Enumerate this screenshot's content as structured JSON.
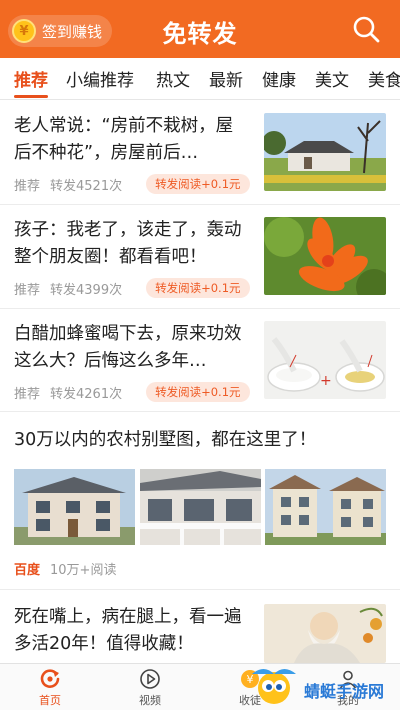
{
  "header": {
    "signin_label": "签到赚钱",
    "title": "免转发"
  },
  "tabs": [
    "推荐",
    "小编推荐",
    "热文",
    "最新",
    "健康",
    "美文",
    "美食"
  ],
  "articles": [
    {
      "title": "老人常说：“房前不栽树，屋后不种花”，房屋前后…",
      "category": "推荐",
      "shares": "转发4521次",
      "badge": "转发阅读+0.1元"
    },
    {
      "title": "孩子：我老了，该走了，轰动整个朋友圈！都看看吧！",
      "category": "推荐",
      "shares": "转发4399次",
      "badge": "转发阅读+0.1元"
    },
    {
      "title": "白醋加蜂蜜喝下去，原来功效这么大？后悔这么多年…",
      "category": "推荐",
      "shares": "转发4261次",
      "badge": "转发阅读+0.1元"
    }
  ],
  "ad": {
    "title": "30万以内的农村别墅图，都在这里了！",
    "source": "百度",
    "reads": "10万+阅读"
  },
  "article4": {
    "title": "死在嘴上，病在腿上，看一遍多活20年！值得收藏！"
  },
  "bottom_nav": [
    "首页",
    "视频",
    "收徒",
    "我的"
  ],
  "watermark": "蜻蜓手游网",
  "colors": {
    "brand": "#f26a22",
    "accent": "#e8501c"
  }
}
